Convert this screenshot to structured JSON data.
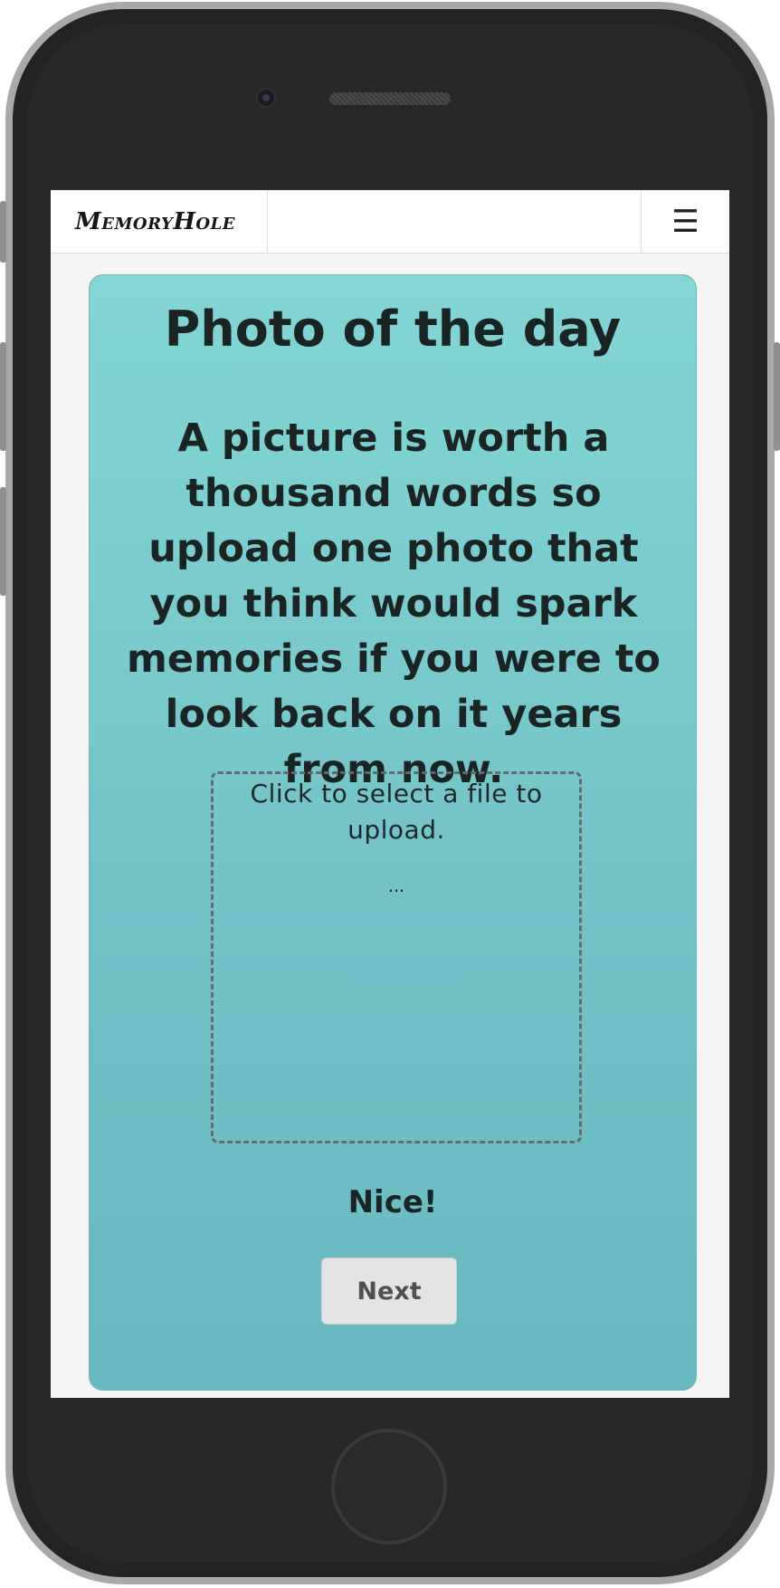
{
  "navbar": {
    "brand": "MemoryHole",
    "menu_icon": "hamburger-icon",
    "menu_glyph": "☰"
  },
  "card": {
    "title": "Photo of the day",
    "prompt": "A picture is worth a thousand words so upload one photo that you think would spark memories if you were to look back on it years from now.",
    "dropzone": {
      "label": "Click to select a file to upload.",
      "status": "..."
    },
    "feedback": "Nice!",
    "next_label": "Next"
  },
  "colors": {
    "card_gradient_top": "#83d6d5",
    "card_gradient_bottom": "#67b8c0",
    "text": "#1a2424",
    "button_bg": "#e3e4e6"
  }
}
